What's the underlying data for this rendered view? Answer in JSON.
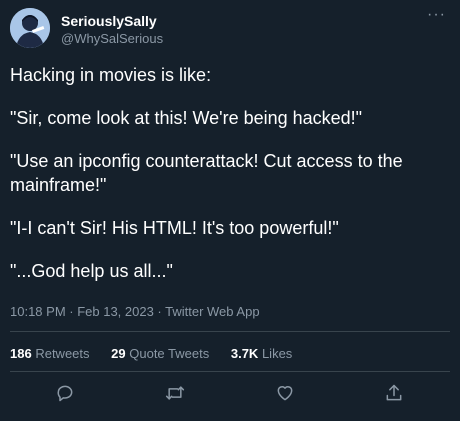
{
  "user": {
    "display_name": "SeriouslySally",
    "handle": "@WhySalSerious"
  },
  "tweet": {
    "paragraphs": [
      "Hacking in movies is like:",
      "\"Sir, come look at this! We're being hacked!\"",
      "\"Use an ipconfig counterattack! Cut access to the mainframe!\"",
      "\"I-I can't Sir! His HTML! It's too powerful!\"",
      "\"...God help us all...\""
    ],
    "timestamp": "10:18 PM · Feb 13, 2023 · Twitter Web App"
  },
  "stats": {
    "retweets_count": "186",
    "retweets_label": "Retweets",
    "quotes_count": "29",
    "quotes_label": "Quote Tweets",
    "likes_count": "3.7K",
    "likes_label": "Likes"
  },
  "icons": {
    "more": "more-icon",
    "reply": "reply-icon",
    "retweet": "retweet-icon",
    "like": "like-icon",
    "share": "share-icon"
  },
  "colors": {
    "background": "#15202b",
    "muted_text": "#8b98a5",
    "divider": "#38444d"
  }
}
